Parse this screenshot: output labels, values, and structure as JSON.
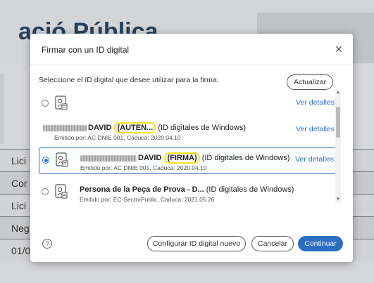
{
  "background": {
    "title": "ació Pública",
    "rows": [
      "Lici",
      "Cor",
      "Lici",
      "Neg",
      "01/0"
    ]
  },
  "dialog": {
    "title": "Firmar con un ID digital",
    "instruction": "Seleccione el ID digital que desee utilizar para la firma:",
    "refresh_label": "Actualizar",
    "ids": [
      {
        "name_hl": "",
        "name_rest": "",
        "type": "",
        "sub": "",
        "details_label": "Ver detalles",
        "selected": false
      },
      {
        "name": "DAVID",
        "name_hl": "(AUTEN...",
        "type": "(ID digitales de Windows)",
        "sub": "Emitido por: AC DNIE 001, Caduca: 2020.04.10",
        "details_label": "Ver detalles",
        "selected": false
      },
      {
        "name": "DAVID",
        "name_hl": "(FIRMA)",
        "type": "(ID digitales de Windows)",
        "sub": "Emitido por: AC DNIE 001, Caduca: 2020.04.10",
        "details_label": "Ver detalles",
        "selected": true
      },
      {
        "name": "Persona de la Peça de Prova - D...",
        "type": "(ID digitales de Windows)",
        "sub": "Emitido por: EC-SectorPublic, Caduca: 2021.05.26",
        "selected": false
      }
    ],
    "help_label": "?",
    "configure_label": "Configurar ID digital nuevo",
    "cancel_label": "Cancelar",
    "continue_label": "Continuar"
  },
  "colors": {
    "accent": "#2b6fc4",
    "highlight_circle": "#f2e21a"
  }
}
